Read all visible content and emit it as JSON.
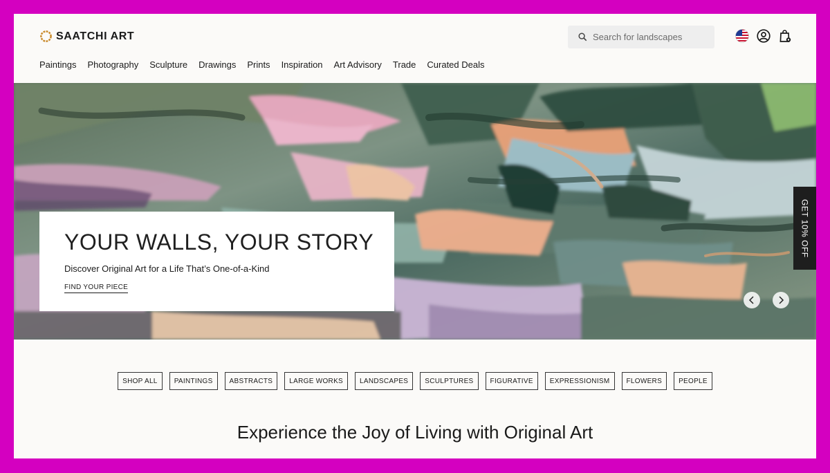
{
  "brand": {
    "name": "SAATCHI ART"
  },
  "search": {
    "placeholder": "Search for landscapes"
  },
  "header_icons": [
    "us-flag-icon",
    "user-account-icon",
    "shopping-bag-icon"
  ],
  "nav": {
    "items": [
      "Paintings",
      "Photography",
      "Sculpture",
      "Drawings",
      "Prints",
      "Inspiration",
      "Art Advisory",
      "Trade",
      "Curated Deals"
    ]
  },
  "hero": {
    "title": "YOUR WALLS, YOUR STORY",
    "subtitle": "Discover Original Art for a Life That’s One-of-a-Kind",
    "cta": "FIND YOUR PIECE",
    "side_tab": "GET 10% OFF",
    "prev_icon": "chevron-left-icon",
    "next_icon": "chevron-right-icon"
  },
  "chips": [
    "SHOP ALL",
    "PAINTINGS",
    "ABSTRACTS",
    "LARGE WORKS",
    "LANDSCAPES",
    "SCULPTURES",
    "FIGURATIVE",
    "EXPRESSIONISM",
    "FLOWERS",
    "PEOPLE"
  ],
  "section": {
    "headline": "Experience the Joy of Living with Original Art"
  },
  "colors": {
    "frame": "#d400c0",
    "page_bg": "#fbfaf8",
    "dark": "#1e1e1e"
  }
}
